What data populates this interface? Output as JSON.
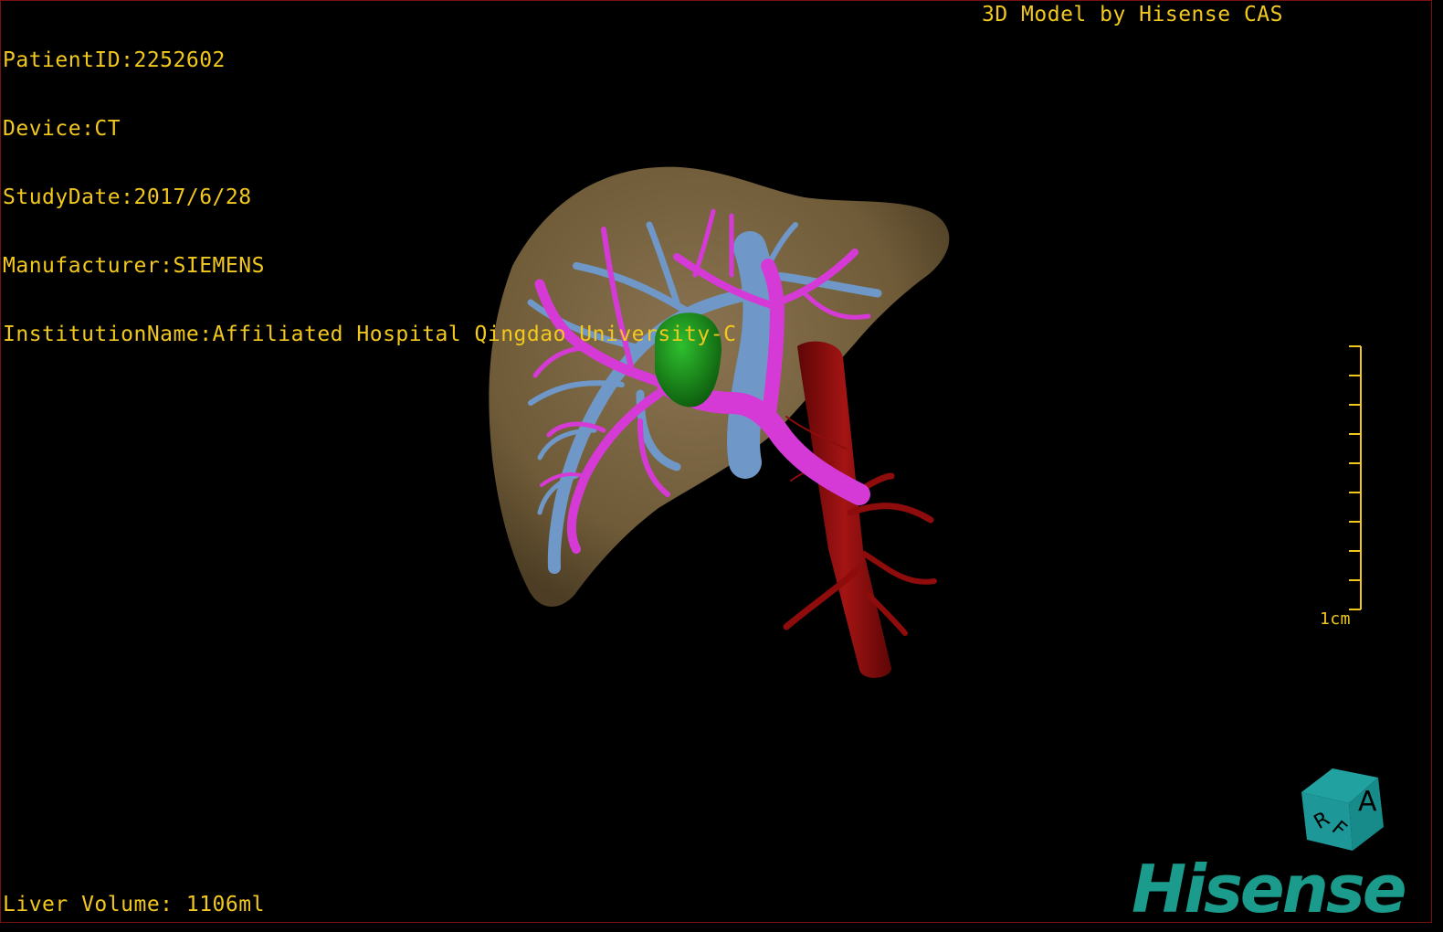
{
  "header": {
    "patient_id": "PatientID:2252602",
    "device": "Device:CT",
    "study_date": "StudyDate:2017/6/28",
    "manufacturer": "Manufacturer:SIEMENS",
    "institution": "InstitutionName:Affiliated Hospital Qingdao University-C"
  },
  "credit": "3D Model by Hisense CAS",
  "footer": {
    "liver_volume": "Liver Volume: 1106ml"
  },
  "scale_bar": {
    "label": "1cm"
  },
  "orientation_cube": {
    "faces": [
      "A",
      "R",
      "F"
    ]
  },
  "logo": {
    "text": "Hisense"
  },
  "model": {
    "structures": [
      "liver",
      "hepatic-vein",
      "portal-vein",
      "tumor",
      "aorta",
      "arteries"
    ]
  },
  "colors": {
    "overlay_text": "#f2c81e",
    "liver": "#7a6440",
    "hepatic_vein": "#6f98c8",
    "portal_vein": "#d63ad6",
    "tumor": "#1a8a1a",
    "artery": "#8e0c0c",
    "brand": "#1a9b8c"
  }
}
